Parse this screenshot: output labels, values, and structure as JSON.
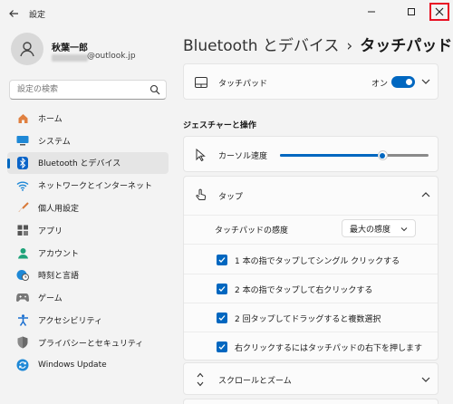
{
  "window": {
    "title": "設定"
  },
  "profile": {
    "name": "秋葉一郎",
    "email_visible": "@outlook.jp"
  },
  "search": {
    "placeholder": "設定の検索"
  },
  "nav": [
    {
      "label": "ホーム",
      "icon": "home-icon"
    },
    {
      "label": "システム",
      "icon": "monitor-icon"
    },
    {
      "label": "Bluetooth とデバイス",
      "icon": "bluetooth-icon",
      "active": true
    },
    {
      "label": "ネットワークとインターネット",
      "icon": "wifi-icon"
    },
    {
      "label": "個人用設定",
      "icon": "brush-icon"
    },
    {
      "label": "アプリ",
      "icon": "apps-icon"
    },
    {
      "label": "アカウント",
      "icon": "person-icon"
    },
    {
      "label": "時刻と言語",
      "icon": "globe-clock-icon"
    },
    {
      "label": "ゲーム",
      "icon": "gamepad-icon"
    },
    {
      "label": "アクセシビリティ",
      "icon": "accessibility-icon"
    },
    {
      "label": "プライバシーとセキュリティ",
      "icon": "shield-icon"
    },
    {
      "label": "Windows Update",
      "icon": "update-icon"
    }
  ],
  "breadcrumb": {
    "parent": "Bluetooth とデバイス",
    "separator": "›",
    "current": "タッチパッド"
  },
  "touchpad": {
    "label": "タッチパッド",
    "state": "オン"
  },
  "gestures": {
    "header": "ジェスチャーと操作"
  },
  "cursor": {
    "label": "カーソル速度",
    "value_fraction": 0.69
  },
  "tap": {
    "label": "タップ",
    "sensitivity_label": "タッチパッドの感度",
    "sensitivity_value": "最大の感度",
    "options": [
      "1 本の指でタップしてシングル クリックする",
      "2 本の指でタップして右クリックする",
      "2 回タップしてドラッグすると複数選択",
      "右クリックするにはタッチパッドの右下を押します"
    ]
  },
  "scroll": {
    "label": "スクロールとズーム"
  },
  "colors": {
    "accent": "#0067c0",
    "close_highlight": "#e81123"
  }
}
